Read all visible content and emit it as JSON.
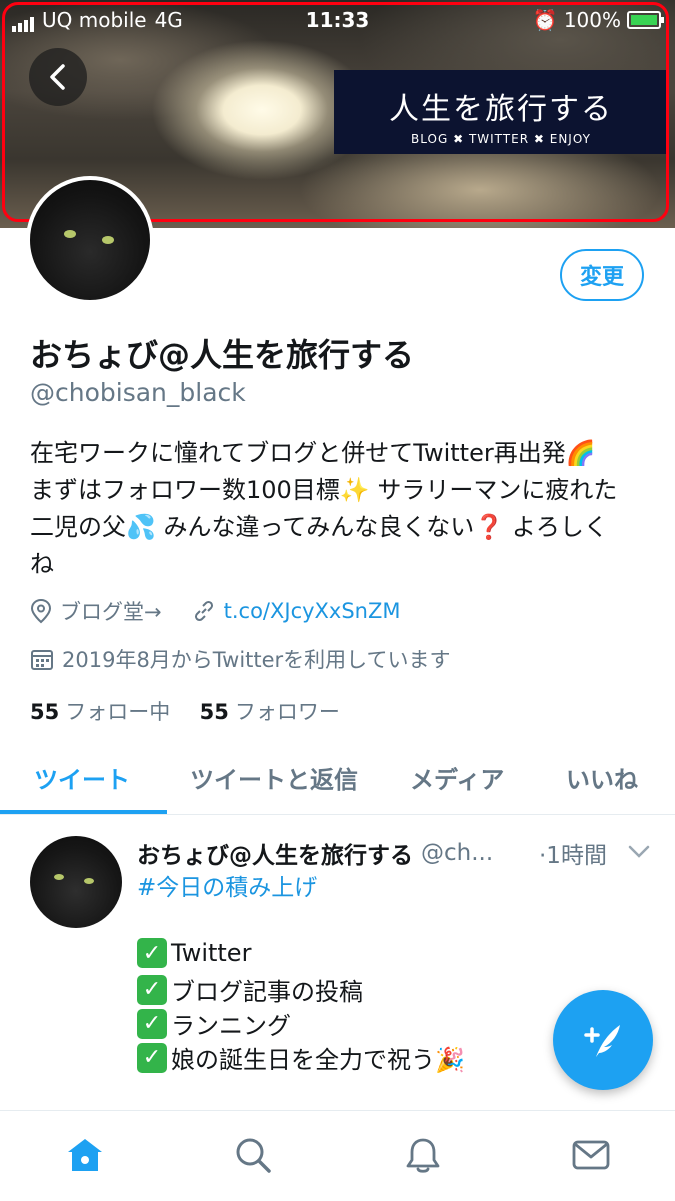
{
  "status_bar": {
    "carrier": "UQ mobile",
    "network": "4G",
    "time": "11:33",
    "battery": "100%"
  },
  "header": {
    "banner_title": "人生を旅行する",
    "banner_subtitle": "BLOG ✖ TWITTER ✖ ENJOY"
  },
  "profile": {
    "edit_label": "変更",
    "display_name": "おちょび@人生を旅行する",
    "handle": "@chobisan_black",
    "bio_lines": [
      "在宅ワークに憧れてブログと併せてTwitter再出発🌈",
      "まずはフォロワー数100目標✨ サラリーマンに疲れた",
      "二児の父💦 みんな違ってみんな良くない❓ よろしく",
      "ね"
    ],
    "location": "ブログ堂→",
    "url": "t.co/XJcyXxSnZM",
    "joined": "2019年8月からTwitterを利用しています",
    "following_count": "55",
    "following_label": "フォロー中",
    "followers_count": "55",
    "followers_label": "フォロワー"
  },
  "tabs": [
    {
      "label": "ツイート",
      "active": true
    },
    {
      "label": "ツイートと返信",
      "active": false
    },
    {
      "label": "メディア",
      "active": false
    },
    {
      "label": "いいね",
      "active": false
    }
  ],
  "tweet": {
    "name": "おちょび@人生を旅行する",
    "handle": "@ch...",
    "time": "·1時間",
    "hashtag": "#今日の積み上げ",
    "checklist": [
      "Twitter",
      "ブログ記事の投稿",
      "ランニング",
      "娘の誕生日を全力で祝う🎉"
    ]
  },
  "bottom_nav": [
    "home-icon",
    "search-icon",
    "bell-icon",
    "mail-icon"
  ],
  "colors": {
    "accent": "#1da1f2",
    "link": "#1b95e0",
    "muted": "#657786",
    "highlight_border": "#ff0010"
  }
}
